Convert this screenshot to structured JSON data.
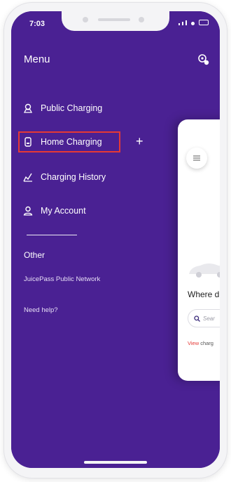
{
  "status_bar": {
    "time": "7:03"
  },
  "menu": {
    "title": "Menu",
    "items": [
      {
        "label": "Public Charging",
        "icon": "charging-station-icon"
      },
      {
        "label": "Home Charging",
        "icon": "home-charger-icon",
        "highlighted": true
      },
      {
        "label": "Charging History",
        "icon": "history-chart-icon"
      },
      {
        "label": "My Account",
        "icon": "user-icon"
      }
    ],
    "other_heading": "Other",
    "links": [
      {
        "label": "JuicePass Public Network"
      },
      {
        "label": "Need help?"
      }
    ]
  },
  "main_card": {
    "where_text": "Where d",
    "search_placeholder": "Sear",
    "view_link": "View",
    "view_rest": " charg"
  },
  "colors": {
    "menu_background": "#4a2193",
    "highlight_border": "#e53935",
    "accent": "#e53935"
  }
}
